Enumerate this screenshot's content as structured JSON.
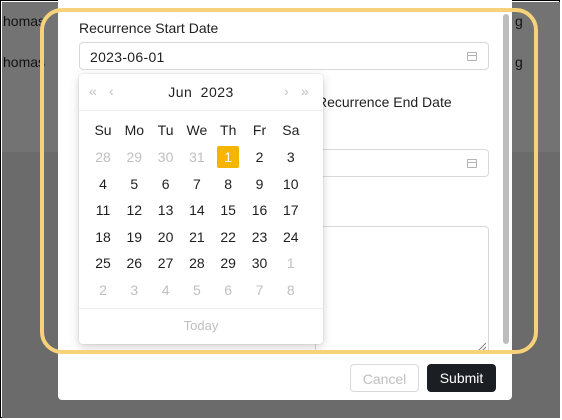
{
  "background": {
    "row1_left": "homas",
    "row1_right": "g",
    "row2_left": "homas",
    "row2_right": "g"
  },
  "form": {
    "start_label": "Recurrence Start Date",
    "start_value": "2023-06-01",
    "end_label": "Recurrence End Date",
    "end_value": ""
  },
  "datepicker": {
    "month": "Jun",
    "year": "2023",
    "weekdays": [
      "Su",
      "Mo",
      "Tu",
      "We",
      "Th",
      "Fr",
      "Sa"
    ],
    "weeks": [
      [
        "28",
        "29",
        "30",
        "31",
        "1",
        "2",
        "3"
      ],
      [
        "4",
        "5",
        "6",
        "7",
        "8",
        "9",
        "10"
      ],
      [
        "11",
        "12",
        "13",
        "14",
        "15",
        "16",
        "17"
      ],
      [
        "18",
        "19",
        "20",
        "21",
        "22",
        "23",
        "24"
      ],
      [
        "25",
        "26",
        "27",
        "28",
        "29",
        "30",
        "1"
      ],
      [
        "2",
        "3",
        "4",
        "5",
        "6",
        "7",
        "8"
      ]
    ],
    "footer": "Today",
    "nav": {
      "prev_year": "«",
      "prev_month": "‹",
      "next_month": "›",
      "next_year": "»"
    }
  },
  "buttons": {
    "cancel": "Cancel",
    "submit": "Submit"
  },
  "colors": {
    "selected": "#f5b400",
    "highlight": "#f7d27b",
    "submit": "#1b1f24"
  }
}
